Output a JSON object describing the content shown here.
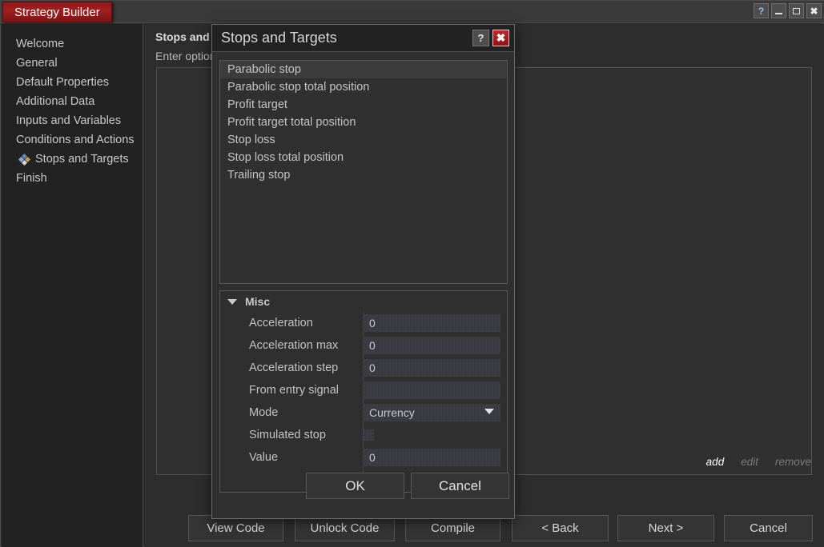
{
  "window": {
    "title": "Strategy Builder",
    "controls": [
      {
        "name": "help",
        "glyph": "?"
      },
      {
        "name": "minimize",
        "glyph": "–"
      },
      {
        "name": "maximize",
        "glyph": "❐"
      },
      {
        "name": "close",
        "glyph": "✖"
      }
    ]
  },
  "sidebar": {
    "items": [
      {
        "label": "Welcome",
        "selected": false
      },
      {
        "label": "General",
        "selected": false
      },
      {
        "label": "Default Properties",
        "selected": false
      },
      {
        "label": "Additional Data",
        "selected": false
      },
      {
        "label": "Inputs and Variables",
        "selected": false
      },
      {
        "label": "Conditions and Actions",
        "selected": false
      },
      {
        "label": "Stops and Targets",
        "selected": true
      },
      {
        "label": "Finish",
        "selected": false
      }
    ]
  },
  "main": {
    "heading": "Stops and Targets",
    "subheading": "Enter options",
    "actions": [
      {
        "label": "add",
        "enabled": true
      },
      {
        "label": "edit",
        "enabled": false
      },
      {
        "label": "remove",
        "enabled": false
      }
    ],
    "buttons": {
      "view_code": "View Code",
      "unlock_code": "Unlock Code",
      "compile": "Compile",
      "back": "< Back",
      "next": "Next >",
      "cancel": "Cancel"
    }
  },
  "dialog": {
    "title": "Stops and Targets",
    "help_glyph": "?",
    "close_glyph": "✖",
    "list": [
      {
        "label": "Parabolic stop",
        "selected": true
      },
      {
        "label": "Parabolic stop total position",
        "selected": false
      },
      {
        "label": "Profit target",
        "selected": false
      },
      {
        "label": "Profit target total position",
        "selected": false
      },
      {
        "label": "Stop loss",
        "selected": false
      },
      {
        "label": "Stop loss total position",
        "selected": false
      },
      {
        "label": "Trailing stop",
        "selected": false
      }
    ],
    "property_grid": {
      "category": "Misc",
      "rows": [
        {
          "label": "Acceleration",
          "value": "0",
          "type": "text"
        },
        {
          "label": "Acceleration max",
          "value": "0",
          "type": "text"
        },
        {
          "label": "Acceleration step",
          "value": "0",
          "type": "text"
        },
        {
          "label": "From entry signal",
          "value": "",
          "type": "text"
        },
        {
          "label": "Mode",
          "value": "Currency",
          "type": "combo"
        },
        {
          "label": "Simulated stop",
          "value": "",
          "type": "checkbox"
        },
        {
          "label": "Value",
          "value": "0",
          "type": "text"
        }
      ]
    },
    "ok_label": "OK",
    "cancel_label": "Cancel"
  },
  "colors": {
    "accent_red": "#a11f1f",
    "window_bg": "#2d2d2d",
    "sidebar_bg": "#222222",
    "field_bg": "#3a3a42",
    "text": "#c9c9c9"
  }
}
